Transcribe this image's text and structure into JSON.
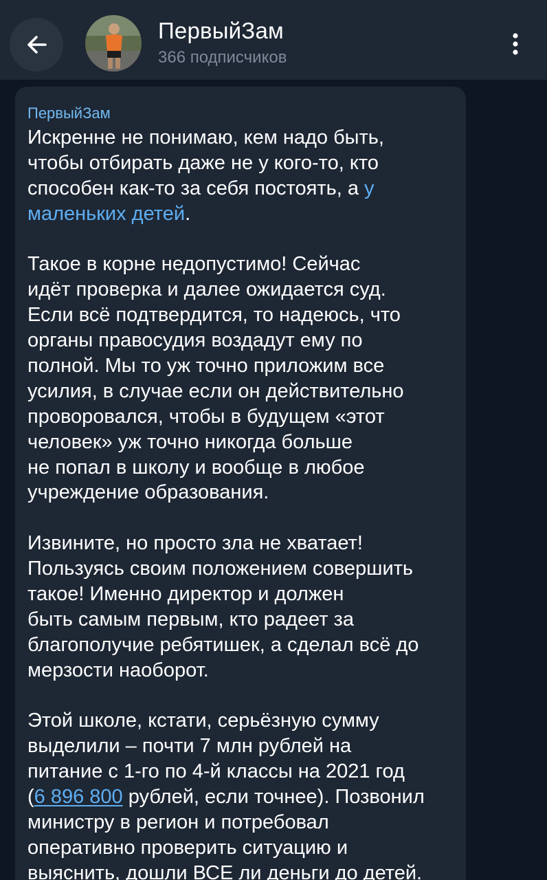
{
  "header": {
    "title": "ПервыйЗам",
    "subtitle": "366 подписчиков"
  },
  "message": {
    "author": "ПервыйЗам",
    "p1": {
      "l1": "Искренне не понимаю, кем надо быть,",
      "l2": "чтобы отбирать даже не у кого-то, кто",
      "l3a": "способен как-то за себя постоять, а ",
      "l3link": "у",
      "l4link": "маленьких детей",
      "l4b": "."
    },
    "p2": [
      "Такое в корне недопустимо! Сейчас",
      "идёт проверка и далее ожидается суд.",
      "Если всё подтвердится, то надеюсь, что",
      "органы правосудия воздадут ему по",
      "полной. Мы то уж точно приложим все",
      "усилия, в случае если он действительно",
      "проворовался, чтобы в будущем «этот",
      "человек» уж точно никогда больше",
      "не попал в школу и вообще в любое",
      "учреждение образования."
    ],
    "p3": [
      "Извините, но просто зла не хватает!",
      "Пользуясь своим положением совершить",
      "такое! Именно директор и должен",
      "быть самым первым, кто радеет за",
      "благополучие ребятишек, а сделал всё до",
      "мерзости наоборот."
    ],
    "p4": {
      "l1": "Этой школе, кстати, серьёзную сумму",
      "l2": "выделили – почти 7 млн рублей на",
      "l3": "питание с 1-го по 4-й классы на 2021 год",
      "l4a": "(",
      "l4link": "6 896 800",
      "l4b": " рублей, если точнее). Позвонил",
      "l5": "министру в регион и потребовал",
      "l6": "оперативно проверить ситуацию и",
      "l7": "выяснить, дошли ВСЕ ли деньги до детей."
    }
  },
  "colors": {
    "background": "#0e1621",
    "header": "#1e2734",
    "bubble": "#1e2734",
    "accent": "#71baf2",
    "link": "#5eaef2"
  },
  "icons": {
    "back": "arrow-left-icon",
    "menu": "more-vertical-icon"
  }
}
